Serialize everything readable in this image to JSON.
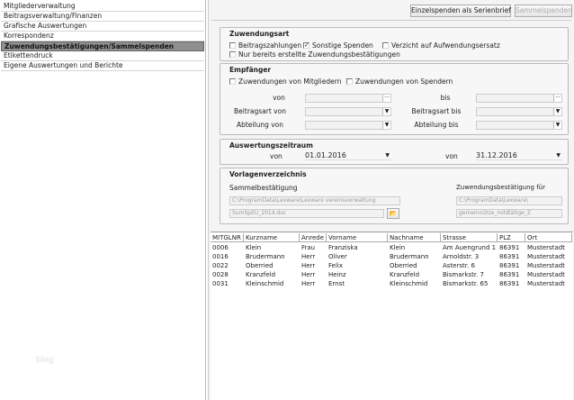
{
  "sidebar": {
    "items": [
      "Mitgliederverwaltung",
      "Beitragsverwaltung/Finanzen",
      "Grafische Auswertungen",
      "Korrespondenz",
      "Zuwendungsbestätigungen/Sammelspenden",
      "Etikettendruck",
      "Eigene Auswertungen und Berichte"
    ],
    "active_index": 4,
    "watermark": "blog"
  },
  "toolbar": {
    "serienbrief": "Einzelspenden als Serienbrief",
    "sammel": "Sammelspenden"
  },
  "zuwendungsart": {
    "title": "Zuwendungsart",
    "options": [
      {
        "label": "Beitragszahlungen",
        "checked": false
      },
      {
        "label": "Sonstige Spenden",
        "checked": true
      },
      {
        "label": "Verzicht auf Aufwendungsersatz",
        "checked": false
      },
      {
        "label": "Nur bereits erstellte Zuwendungsbestätigungen",
        "checked": false
      }
    ]
  },
  "empfaenger": {
    "title": "Empfänger",
    "mitglieder": "Zuwendungen von Mitgliedern",
    "spender": "Zuwendungen von Spendern",
    "von": "von",
    "bis": "bis",
    "beitragsart_von": "Beitragsart von",
    "beitragsart_bis": "Beitragsart bis",
    "abteilung_von": "Abteilung von",
    "abteilung_bis": "Abteilung bis"
  },
  "zeitraum": {
    "title": "Auswertungszeitraum",
    "von_label": "von",
    "von": "01.01.2016",
    "bis_label": "von",
    "bis": "31.12.2016"
  },
  "vorlagen": {
    "title": "Vorlagenverzeichnis",
    "sammel_label": "Sammelbestätigung",
    "sammel_path": "C:\\ProgramData\\Lexware\\Lexware vereinsverwaltung",
    "sammel_file": "SumSpEU_2014.doc",
    "zuw_label": "Zuwendungsbestätigung für",
    "zuw_path": "C:\\ProgramData\\Lexware\\",
    "zuw_file": "gemeinnütze_mildtätige_Z"
  },
  "table": {
    "columns": [
      "MITGLNR",
      "Kurzname",
      "Anrede",
      "Vorname",
      "Nachname",
      "Strasse",
      "PLZ",
      "Ort"
    ],
    "rows": [
      [
        "0006",
        "Klein",
        "Frau",
        "Franziska",
        "Klein",
        "Am Auengrund 1",
        "86391",
        "Musterstadt"
      ],
      [
        "0016",
        "Brudermann",
        "Herr",
        "Oliver",
        "Brudermann",
        "Arnoldstr. 3",
        "86391",
        "Musterstadt"
      ],
      [
        "0022",
        "Oberried",
        "Herr",
        "Felix",
        "Oberried",
        "Asterstr. 6",
        "86391",
        "Musterstadt"
      ],
      [
        "0028",
        "Kranzfeld",
        "Herr",
        "Heinz",
        "Kranzfeld",
        "Bismarkstr. 7",
        "86391",
        "Musterstadt"
      ],
      [
        "0031",
        "Kleinschmid",
        "Herr",
        "Ernst",
        "Kleinschmid",
        "Bismarkstr. 65",
        "86391",
        "Musterstadt"
      ]
    ]
  }
}
